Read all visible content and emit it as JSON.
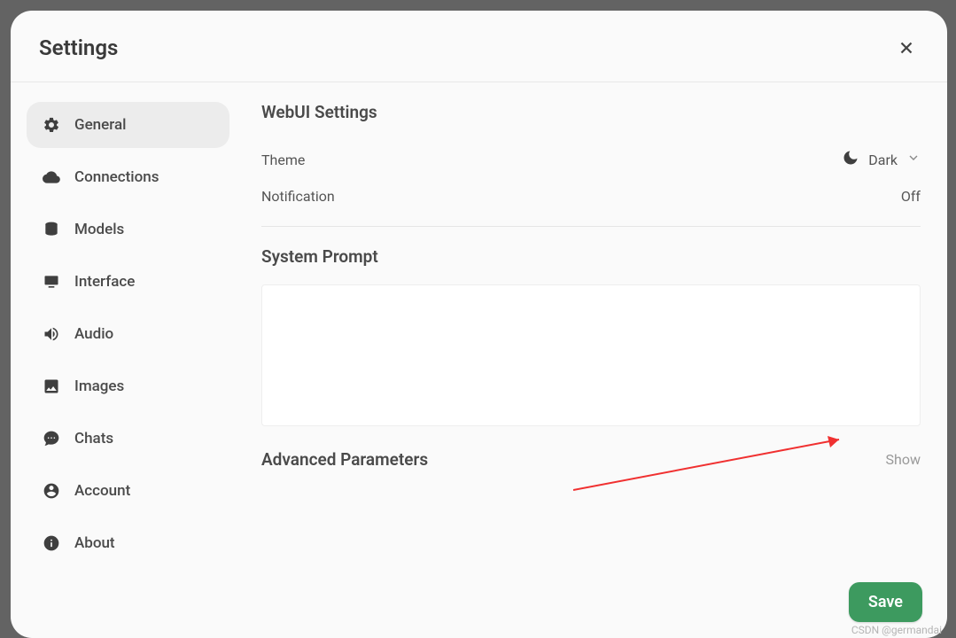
{
  "header": {
    "title": "Settings"
  },
  "sidebar": {
    "items": [
      {
        "label": "General"
      },
      {
        "label": "Connections"
      },
      {
        "label": "Models"
      },
      {
        "label": "Interface"
      },
      {
        "label": "Audio"
      },
      {
        "label": "Images"
      },
      {
        "label": "Chats"
      },
      {
        "label": "Account"
      },
      {
        "label": "About"
      }
    ]
  },
  "content": {
    "webui_title": "WebUI Settings",
    "theme_label": "Theme",
    "theme_value": "Dark",
    "notification_label": "Notification",
    "notification_value": "Off",
    "system_prompt_title": "System Prompt",
    "system_prompt_value": "",
    "advanced_title": "Advanced Parameters",
    "advanced_toggle": "Show",
    "save_label": "Save"
  },
  "watermark": "CSDN @germandai"
}
